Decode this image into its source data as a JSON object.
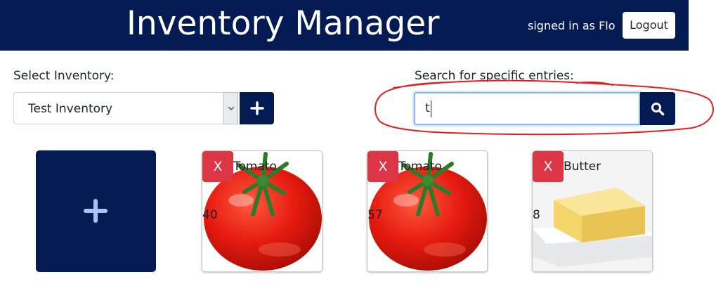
{
  "header": {
    "title": "Inventory Manager",
    "signed_in": "signed in as Flo",
    "logout_label": "Logout"
  },
  "inventory": {
    "label": "Select Inventory:",
    "selected": "Test Inventory",
    "add_icon": "plus-icon"
  },
  "search": {
    "label": "Search for specific entries:",
    "value": "t",
    "icon": "search-icon"
  },
  "items": [
    {
      "name": "Tomato",
      "quantity": "40",
      "delete_label": "X",
      "image": "tomato"
    },
    {
      "name": "Tomato",
      "quantity": "57",
      "delete_label": "X",
      "image": "tomato"
    },
    {
      "name": "Butter",
      "quantity": "8",
      "delete_label": "X",
      "image": "butter"
    }
  ],
  "colors": {
    "navy": "#031a52",
    "danger": "#dc3545",
    "annotation": "#e0201e",
    "plus_light": "#a9c4f0"
  }
}
